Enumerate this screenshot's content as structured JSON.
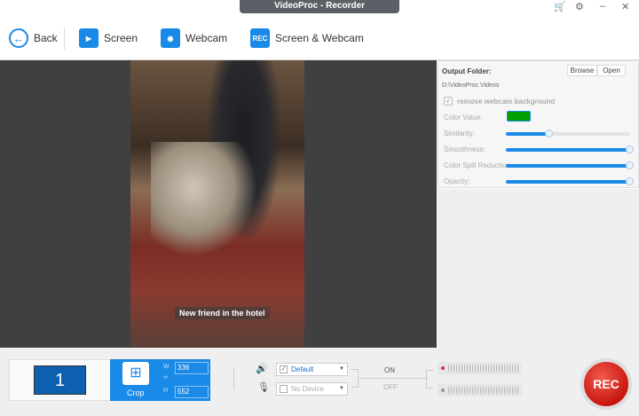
{
  "window": {
    "title": "VideoProc - Recorder",
    "cart": "🛒",
    "settings": "⚙",
    "minimize": "–",
    "close": "✕"
  },
  "toolbar": {
    "back": "Back",
    "screen": "Screen",
    "webcam": "Webcam",
    "screen_webcam": "Screen & Webcam",
    "rec_icon": "REC"
  },
  "preview": {
    "caption": "New friend in the hotel"
  },
  "panel": {
    "output_folder_label": "Output Folder:",
    "browse": "Browse",
    "open": "Open",
    "path": "D:\\VideoProc Videos",
    "remove_bg": "remove webcam background",
    "color_value": "Color Value:",
    "color": "#00a000",
    "similarity": "Similarity:",
    "similarity_value": 0.35,
    "smoothness": "Smoothness:",
    "smoothness_value": 1.0,
    "spill": "Color Spill Reduction:",
    "spill_value": 1.0,
    "opacity": "Opacity:",
    "opacity_value": 1.0
  },
  "bottom": {
    "monitor": "1",
    "crop": "Crop",
    "w_label": "W",
    "h_label": "H",
    "width": "336",
    "height": "552",
    "speaker": "Default",
    "mic": "No Device",
    "on": "ON",
    "off": "OFF",
    "rec": "REC"
  }
}
